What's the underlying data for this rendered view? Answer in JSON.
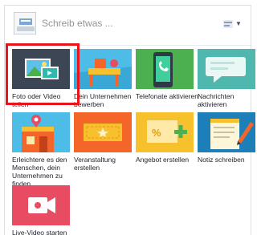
{
  "composer": {
    "placeholder": "Schreib etwas ..."
  },
  "options": [
    {
      "label": "Foto oder Video teilen",
      "icon": "photo-video-icon",
      "color": "#3c4654"
    },
    {
      "label": "Dein Unternehmen bewerben",
      "icon": "promote-business-icon",
      "color": "#4dbde8"
    },
    {
      "label": "Telefonate aktivieren",
      "icon": "phone-call-icon",
      "color": "#4caf50"
    },
    {
      "label": "Nachrichten aktivieren",
      "icon": "message-bubble-icon",
      "color": "#4fb7ad"
    },
    {
      "label": "Erleichtere es den Menschen, dein Unternehmen zu finden",
      "icon": "location-shop-icon",
      "color": "#4dbde8"
    },
    {
      "label": "Veranstaltung erstellen",
      "icon": "event-ticket-icon",
      "color": "#f4652a"
    },
    {
      "label": "Angebot erstellen",
      "icon": "offer-coupon-icon",
      "color": "#f7c12d"
    },
    {
      "label": "Notiz schreiben",
      "icon": "note-pencil-icon",
      "color": "#1c7fb8"
    },
    {
      "label": "Live-Video starten",
      "icon": "live-video-icon",
      "color": "#e84c63"
    }
  ],
  "highlight_color": "#e8141b"
}
